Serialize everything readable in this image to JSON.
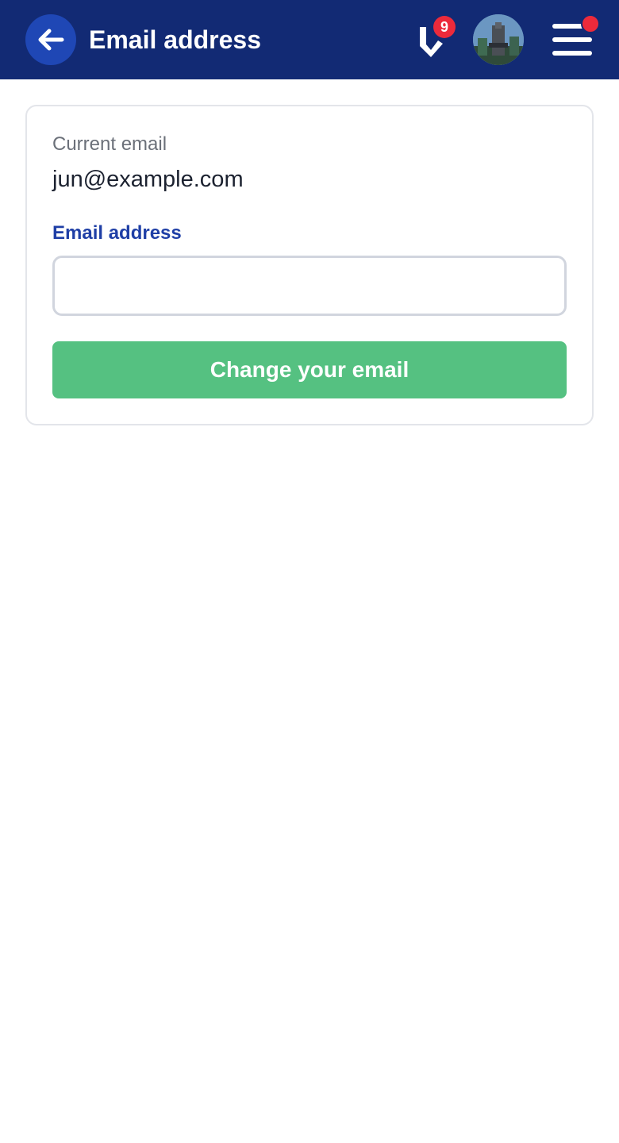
{
  "header": {
    "title": "Email address",
    "notification_count": "9",
    "icons": {
      "back": "arrow-left-icon",
      "brand": "brand-logo-icon",
      "avatar": "user-avatar",
      "menu": "hamburger-menu-icon"
    }
  },
  "card": {
    "current_label": "Current email",
    "current_value": "jun@example.com",
    "field_label": "Email address",
    "input_value": "",
    "input_placeholder": "",
    "button_label": "Change your email"
  },
  "colors": {
    "header_bg": "#122a74",
    "back_button_bg": "#1f47b5",
    "badge": "#ec2a3b",
    "field_label": "#1f3fa6",
    "button_bg": "#55c181"
  }
}
